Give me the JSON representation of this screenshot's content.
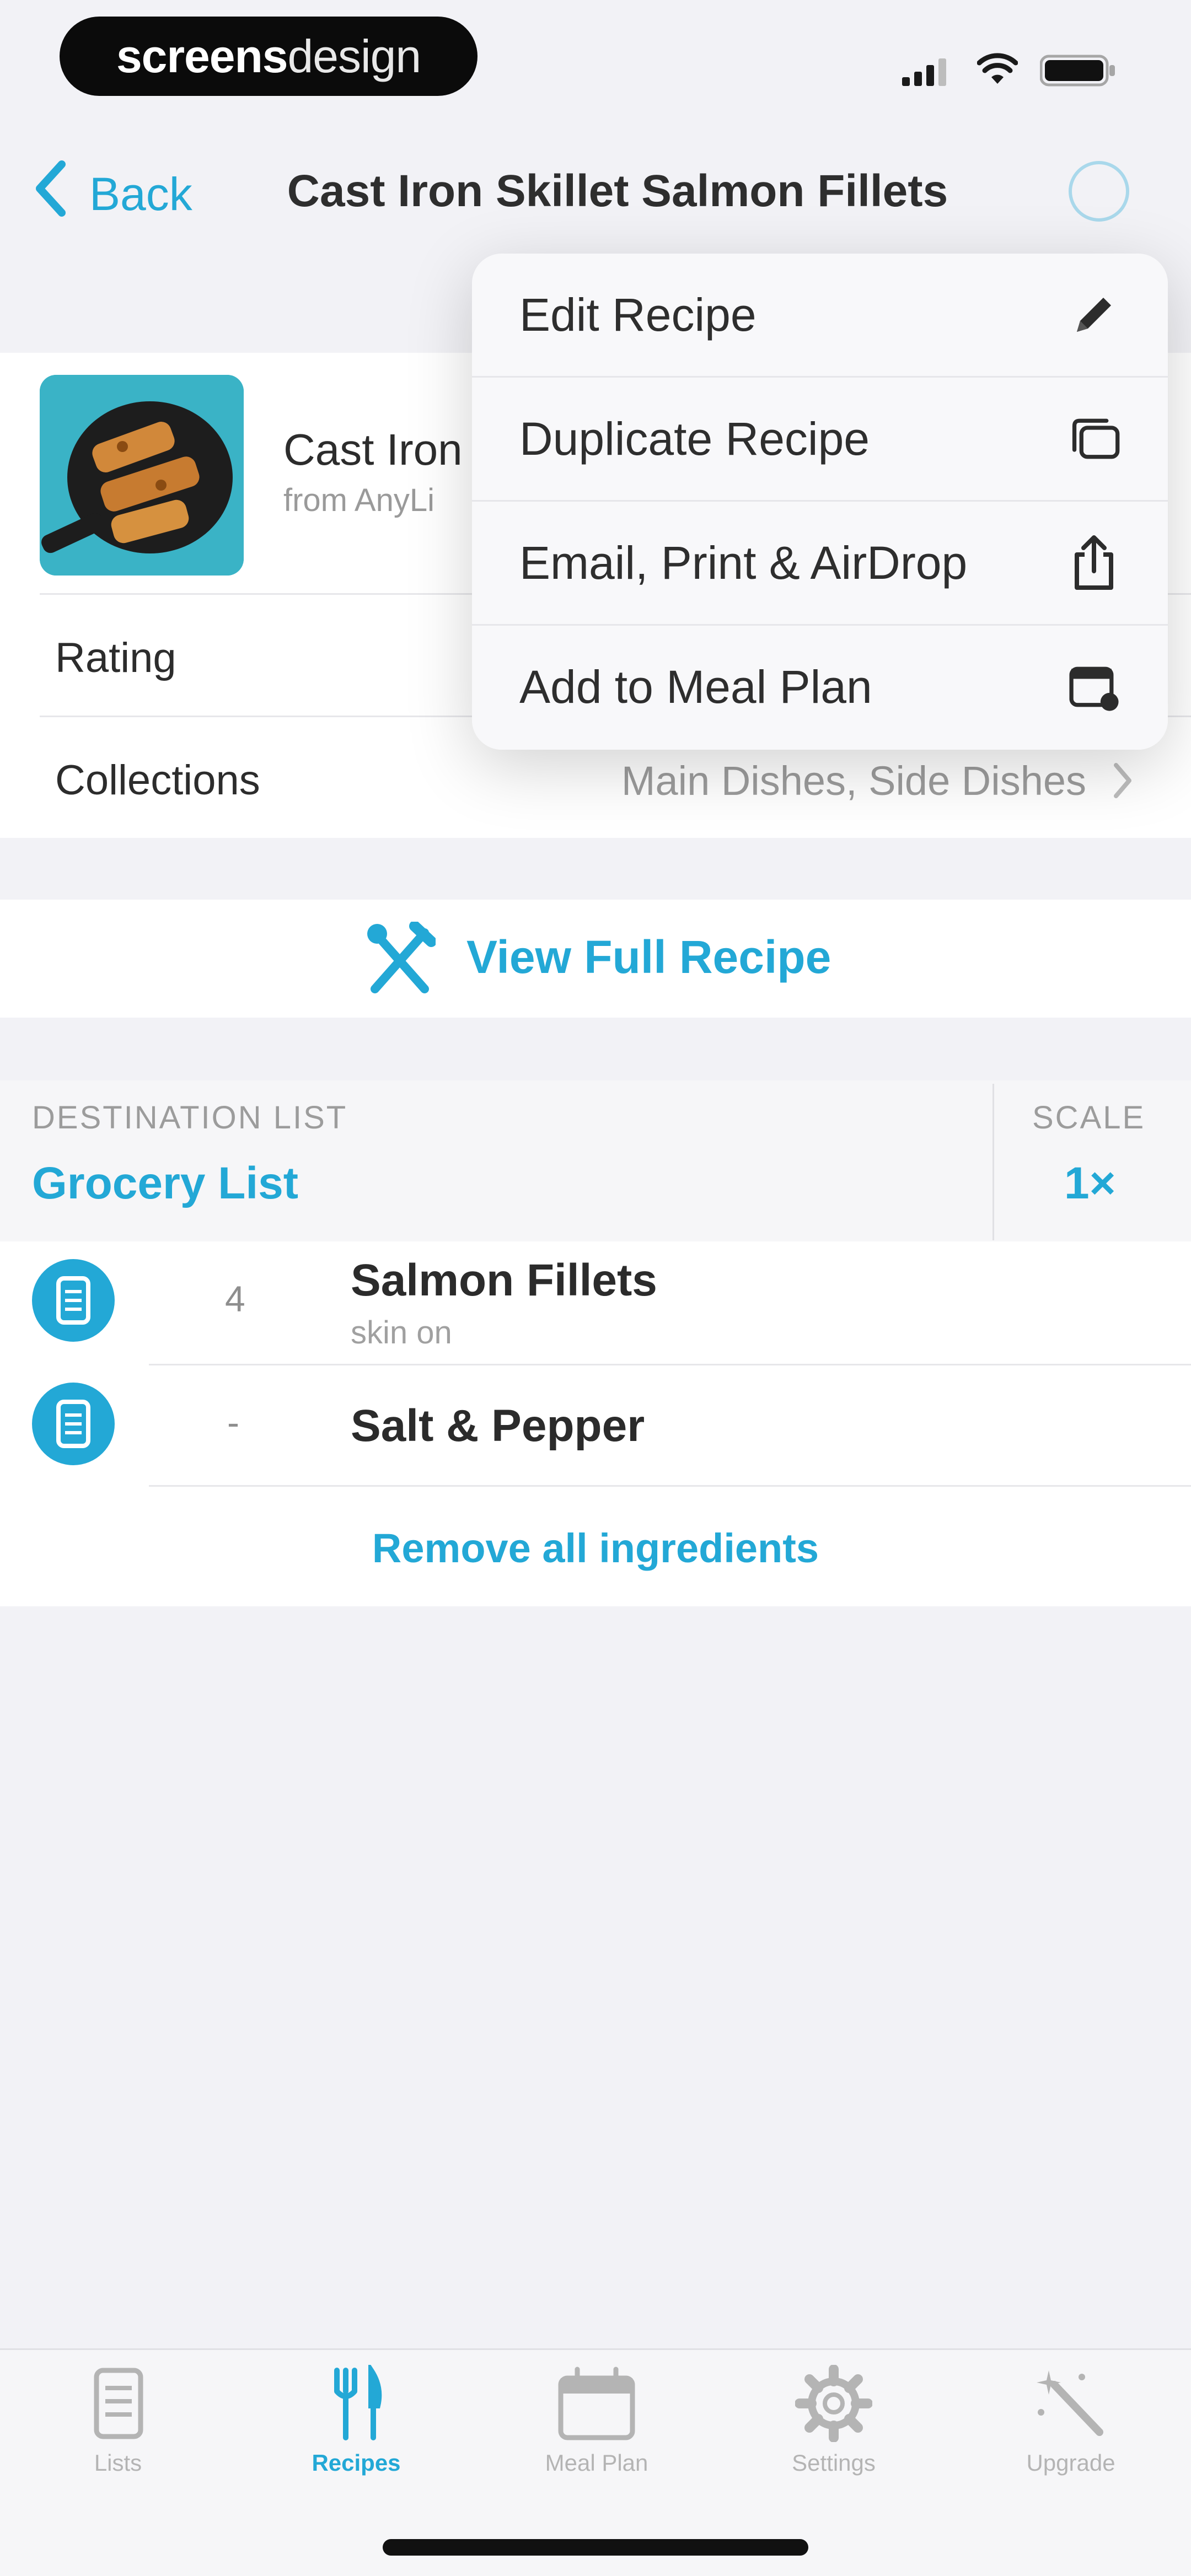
{
  "status_bar": {
    "brand_bold": "screens",
    "brand_light": "design"
  },
  "nav": {
    "back_label": "Back",
    "title": "Cast Iron Skillet Salmon Fillets"
  },
  "recipe_card": {
    "name": "Cast Iron",
    "source": "from AnyLi",
    "rating_label": "Rating",
    "collections_label": "Collections",
    "collections_value": "Main Dishes, Side Dishes"
  },
  "menu": {
    "items": [
      {
        "label": "Edit Recipe",
        "icon": "pencil-icon"
      },
      {
        "label": "Duplicate Recipe",
        "icon": "duplicate-icon"
      },
      {
        "label": "Email, Print & AirDrop",
        "icon": "share-icon"
      },
      {
        "label": "Add to Meal Plan",
        "icon": "calendar-add-icon"
      }
    ]
  },
  "view_full_recipe": {
    "label": "View Full Recipe",
    "icon": "fork-knife-icon"
  },
  "destination": {
    "label": "DESTINATION LIST",
    "value": "Grocery List",
    "scale_label": "SCALE",
    "scale_value": "1×"
  },
  "ingredients": [
    {
      "qty": "4",
      "name": "Salmon Fillets",
      "note": "skin on"
    },
    {
      "qty": "-",
      "name": "Salt & Pepper",
      "note": ""
    }
  ],
  "remove_all_label": "Remove all ingredients",
  "tabbar": {
    "items": [
      {
        "label": "Lists",
        "icon": "list-icon",
        "active": false
      },
      {
        "label": "Recipes",
        "icon": "recipes-icon",
        "active": true
      },
      {
        "label": "Meal Plan",
        "icon": "calendar-icon",
        "active": false
      },
      {
        "label": "Settings",
        "icon": "gear-icon",
        "active": false
      },
      {
        "label": "Upgrade",
        "icon": "magic-wand-icon",
        "active": false
      }
    ]
  },
  "colors": {
    "accent": "#23a8d6",
    "background": "#f2f2f6",
    "text": "#2b2b2b",
    "muted": "#9c9c9c"
  }
}
